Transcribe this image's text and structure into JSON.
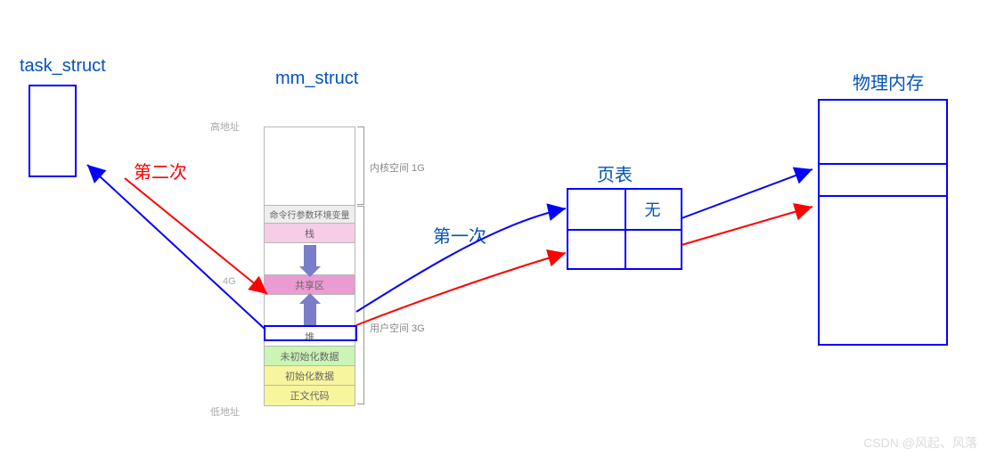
{
  "labels": {
    "task_struct": "task_struct",
    "mm_struct": "mm_struct",
    "page_table": "页表",
    "phys_mem": "物理内存",
    "first": "第一次",
    "second": "第二次",
    "pt_none": "无",
    "high_addr": "高地址",
    "low_addr": "低地址",
    "size_4g": "4G",
    "kernel_space": "内核空间 1G",
    "user_space": "用户空间 3G"
  },
  "segments": {
    "cmdline": "命令行参数环境变量",
    "stack": "栈",
    "shared": "共享区",
    "heap": "堆",
    "bss": "未初始化数据",
    "data": "初始化数据",
    "text": "正文代码"
  },
  "watermark": "CSDN @风起、风落",
  "colors": {
    "blue": "#0300ff",
    "label_blue": "#0353bd",
    "red": "#ff0000"
  }
}
